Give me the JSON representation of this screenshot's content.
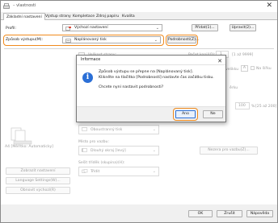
{
  "window": {
    "title": "– vlastnosti",
    "close_glyph": "✕"
  },
  "tabs": [
    {
      "label": "Základní nastavení",
      "active": true
    },
    {
      "label": "Výstup strany",
      "active": false
    },
    {
      "label": "Kompletace",
      "active": false
    },
    {
      "label": "Zdroj papíru",
      "active": false
    },
    {
      "label": "Kvalita",
      "active": false
    }
  ],
  "top": {
    "profile_label": "Profil:",
    "profile_value": "Výchozí nastavení",
    "add_button": "Přidat(1)...",
    "edit_button": "Upravit(2)...",
    "output_method_label": "Způsob výstupu(M):",
    "output_method_value": "Naplánovaný tisk",
    "details_button": "Podrobnosti(Z)..."
  },
  "background": {
    "page_size_label": "Velikost strany:",
    "copies_label": "Počet kopií(O):",
    "copies_value": "1",
    "copies_range": "[1 až 9999]",
    "fit_label": "velikku",
    "fit_value": "A",
    "paper_label": "Na šířku",
    "scale_range": "[25 až 200]",
    "scale_value": "100",
    "scale_unit": "%",
    "sub_label": "ěrku",
    "preview_caption": "A4 [Měřítko: Automaticky]",
    "print_style_value": "Oboustranný tisk",
    "where_label": "Místo pro vazbu:",
    "where_value": "Dlouhý okraj [levý]",
    "margin_button": "Nezera pro vazbu(Z)...",
    "staple_label": "Sešit tříděk (skupina)(H):",
    "staple_value": "Třídit",
    "show_settings_button": "Zobrazit nastavení",
    "language_button": "Language Settings(W)...",
    "restore_button": "Obnovit výchozí(R)"
  },
  "dialog": {
    "title": "Informace",
    "icon_glyph": "i",
    "message_line1": "Způsob výstupu se přepne na [Naplánovaný tisk].",
    "message_line2": "Klikněte na tlačítko [Podrobnosti] nastavte čas začátku tisku.",
    "question": "Chcete nyní nastavit podrobnosti?",
    "yes_button": "Ano",
    "no_button": "Ne"
  },
  "footer": {
    "ok_button": "OK",
    "cancel_button": "Zrušit",
    "help_button": "Nápověda"
  },
  "colors": {
    "highlight_frame": "#f08a1c",
    "info_icon": "#2b6fd6"
  }
}
